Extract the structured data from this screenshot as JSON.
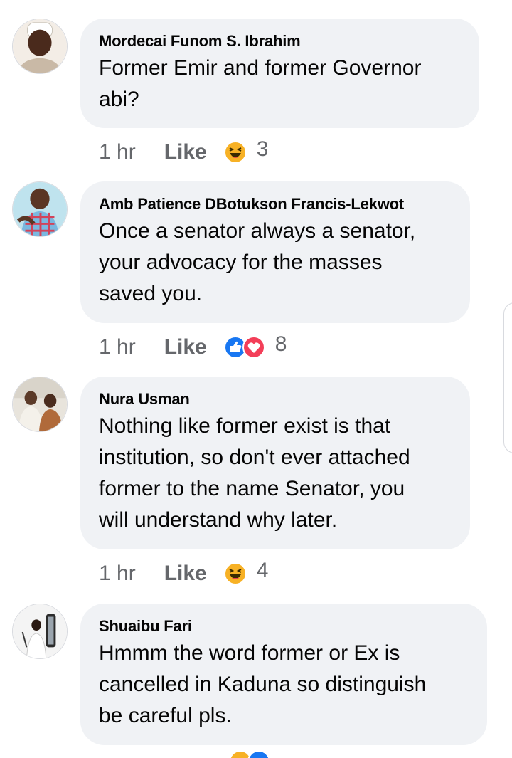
{
  "comments": [
    {
      "author": "Mordecai Funom S. Ibrahim",
      "lines": [
        "Former Emir and former Governor",
        "abi?"
      ],
      "time": "1 hr",
      "like_label": "Like",
      "reactions": [
        "haha"
      ],
      "reaction_count": "3"
    },
    {
      "author": "Amb Patience DBotukson Francis-Lekwot",
      "lines": [
        "Once a senator always a senator,",
        "your advocacy for the masses",
        "saved you."
      ],
      "time": "1 hr",
      "like_label": "Like",
      "reactions": [
        "like",
        "love"
      ],
      "reaction_count": "8"
    },
    {
      "author": "Nura Usman",
      "lines": [
        "Nothing like former exist is that",
        "institution, so don't ever attached",
        "former to the name Senator, you",
        "will understand why later."
      ],
      "time": "1 hr",
      "like_label": "Like",
      "reactions": [
        "haha"
      ],
      "reaction_count": "4"
    },
    {
      "author": "Shuaibu Fari",
      "lines": [
        "Hmmm the word former or Ex is",
        "cancelled in Kaduna so distinguish",
        "be careful pls."
      ],
      "time": "",
      "like_label": "",
      "reactions": [
        "haha",
        "like"
      ],
      "reaction_count": ""
    }
  ],
  "colors": {
    "bubble": "#f0f2f5",
    "meta_text": "#65676b",
    "like_blue": "#1877f2",
    "love_red": "#f33e58",
    "haha_yellow": "#f7b125"
  }
}
